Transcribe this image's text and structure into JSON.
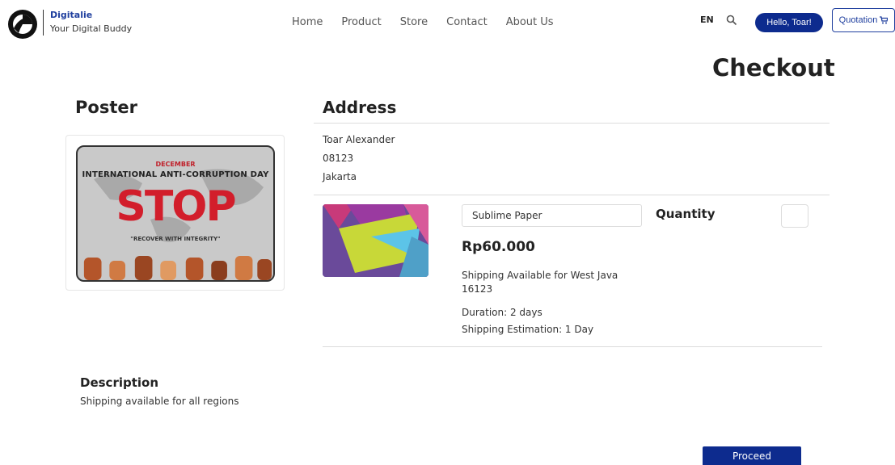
{
  "header": {
    "brand_name": "Digitalie",
    "brand_tagline": "Your Digital Buddy",
    "nav": [
      "Home",
      "Product",
      "Store",
      "Contact",
      "About Us"
    ],
    "language": "EN",
    "hello_label": "Hello, Toar!",
    "quotation_label": "Quotation"
  },
  "page_title": "Checkout",
  "poster": {
    "title": "Poster",
    "image": {
      "month": "DECEMBER",
      "headline": "INTERNATIONAL ANTI-CORRUPTION DAY",
      "stop_text": "STOP",
      "subtext": "\"RECOVER WITH INTEGRITY\""
    }
  },
  "address": {
    "title": "Address",
    "name": "Toar Alexander",
    "phone": "08123",
    "city": "Jakarta"
  },
  "product": {
    "name": "Sublime Paper",
    "quantity_label": "Quantity",
    "price": "Rp60.000",
    "shipping": "Shipping Available for West Java",
    "postal": "16123",
    "duration": "Duration: 2 days",
    "estimation": "Shipping Estimation: 1 Day"
  },
  "description": {
    "title": "Description",
    "text": "Shipping available for all regions"
  },
  "proceed_label": "Proceed",
  "colors": {
    "primary": "#0d2b8e",
    "brand": "#1f3f9e",
    "stop_red": "#d21e2b"
  }
}
